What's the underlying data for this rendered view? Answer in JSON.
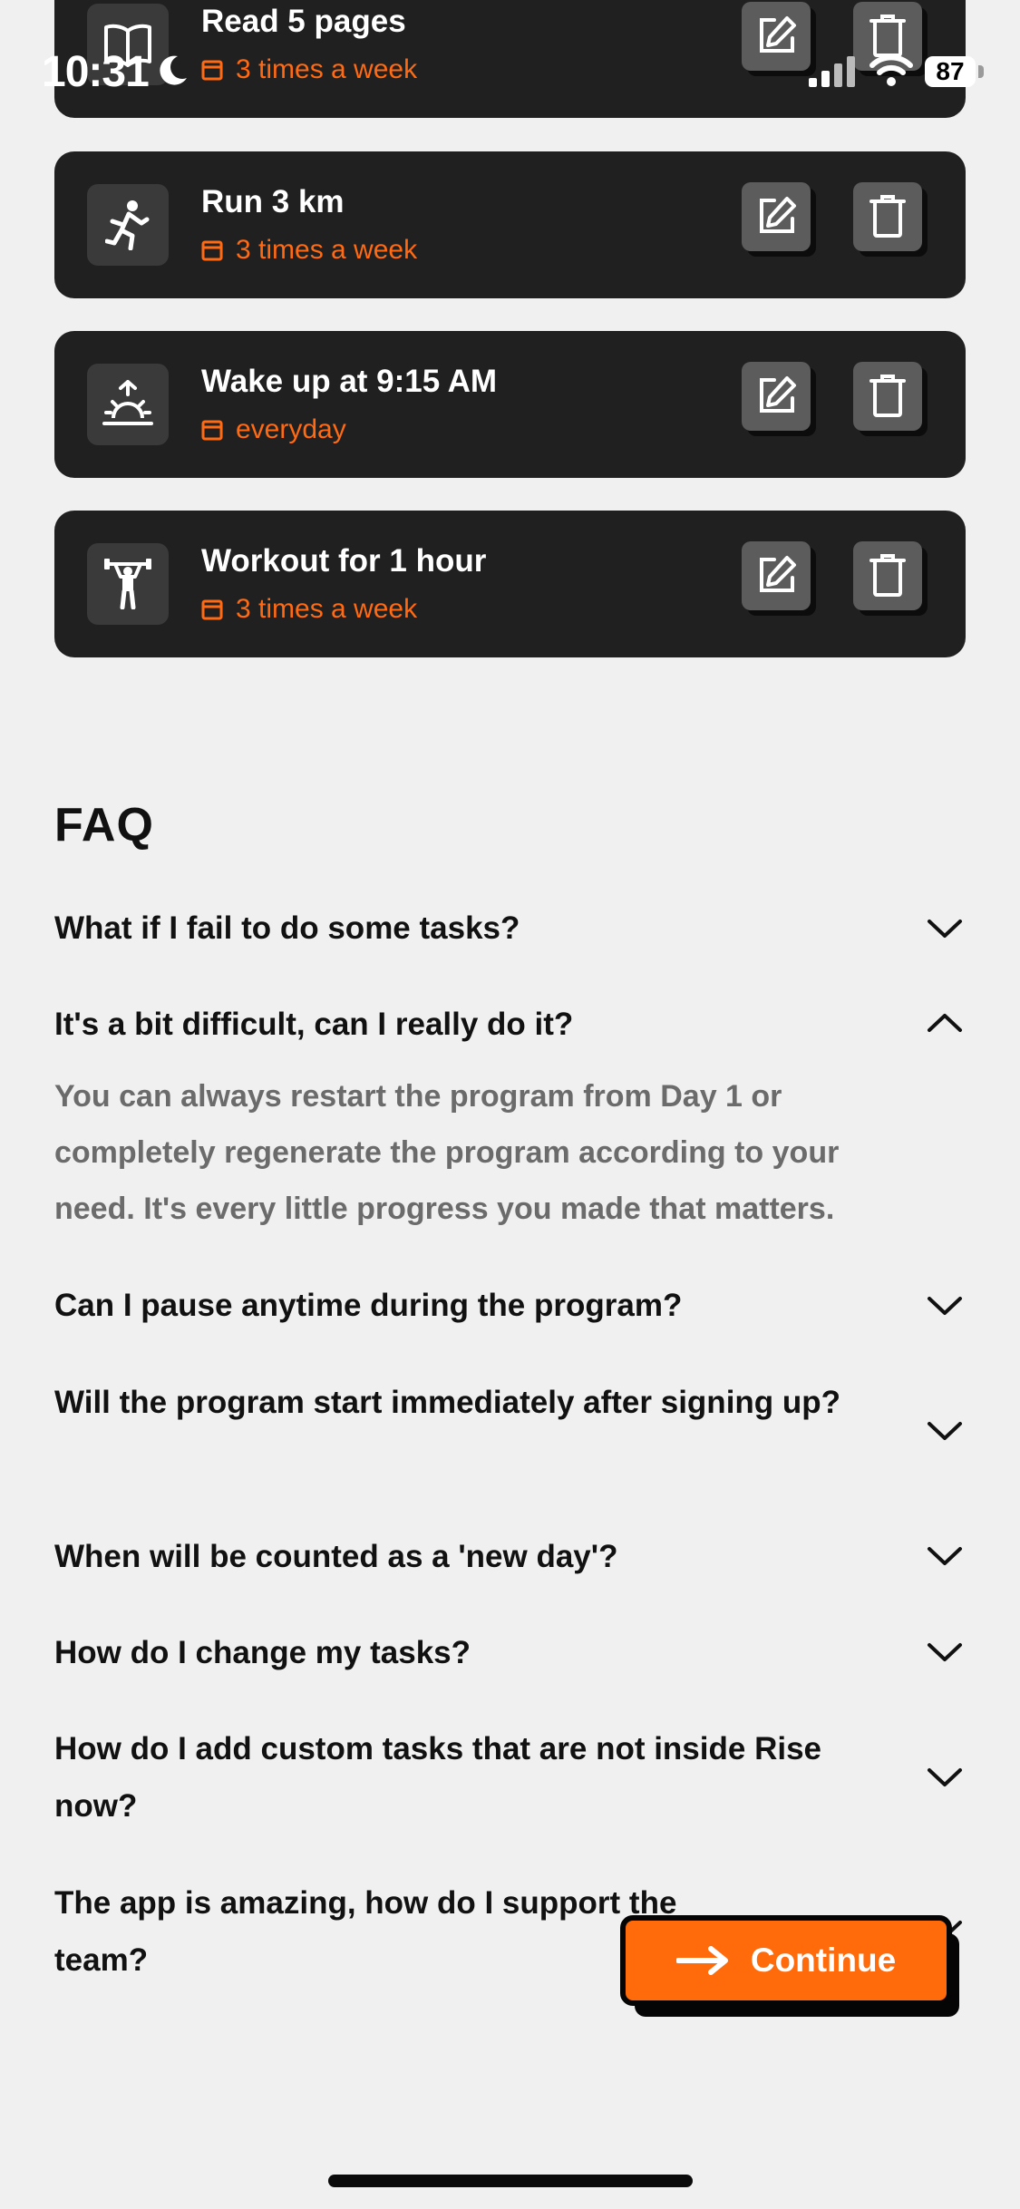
{
  "status_bar": {
    "time": "10:31",
    "battery": "87"
  },
  "tasks": [
    {
      "title": "Read 5 pages",
      "frequency": "3 times a week",
      "icon": "book-icon"
    },
    {
      "title": "Run 3 km",
      "frequency": "3 times a week",
      "icon": "runner-icon"
    },
    {
      "title": "Wake up at 9:15 AM",
      "frequency": "everyday",
      "icon": "sunrise-icon"
    },
    {
      "title": "Workout for 1 hour",
      "frequency": "3 times a week",
      "icon": "weightlifter-icon"
    }
  ],
  "faq": {
    "title": "FAQ",
    "questions": [
      "What if I fail to do some tasks?",
      "It's a bit difficult, can I really do it?",
      "Can I pause anytime during the program?",
      "Will the program start immediately after signing up?",
      "When will be counted as a 'new day'?",
      "How do I change my tasks?",
      "How do I add custom tasks that are not inside Rise now?",
      "The app is amazing, how do I support the team?"
    ],
    "expanded_answer": "You can always restart the program from Day 1 or completely regenerate the program according to your need. It's every little progress you made that matters."
  },
  "continue_label": "Continue",
  "colors": {
    "accent": "#ff6a13",
    "card": "#202020",
    "background": "#f0f0f0"
  }
}
